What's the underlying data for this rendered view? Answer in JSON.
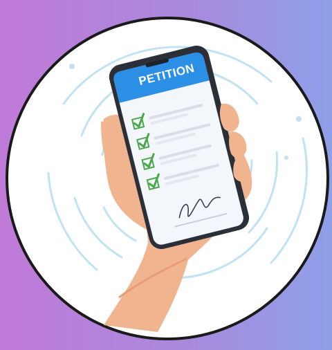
{
  "illustration": {
    "screen_title": "PETITION",
    "checked_items": 4,
    "colors": {
      "background_left": "#c07ad8",
      "background_right": "#8ea0e8",
      "circle_fill": "#ffffff",
      "circle_border": "#1a1a1a",
      "ring_color": "#bfe3f1",
      "phone_body": "#2a2f38",
      "phone_header": "#2b8fe6",
      "check_color": "#4aa84a",
      "skin": "#f0b48e"
    },
    "icons": [
      "phone-icon",
      "hand-icon",
      "checkbox-icon",
      "signature-icon"
    ]
  }
}
